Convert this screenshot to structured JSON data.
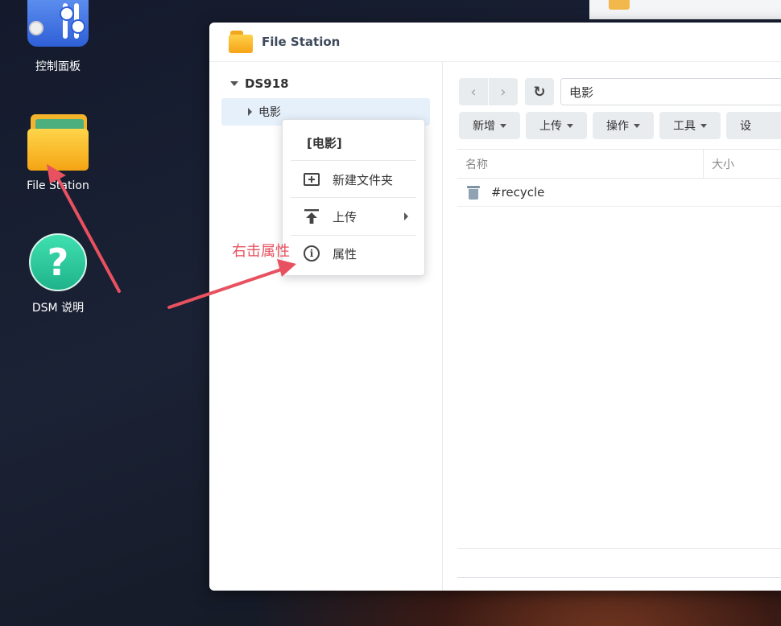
{
  "desktop": {
    "icons": [
      {
        "label": "控制面板",
        "icon": "control-panel-icon"
      },
      {
        "label": "File Station",
        "icon": "folder-icon"
      },
      {
        "label": "DSM 说明",
        "icon": "help-icon"
      }
    ]
  },
  "window": {
    "title": "File Station",
    "tree": {
      "root": "DS918",
      "items": [
        "电影"
      ]
    },
    "path": "电影",
    "toolbar": [
      "新增",
      "上传",
      "操作",
      "工具",
      "设"
    ],
    "columns": {
      "name": "名称",
      "size": "大小"
    },
    "rows": [
      {
        "name": "#recycle",
        "icon": "trash-icon"
      }
    ]
  },
  "context_menu": {
    "title": "[电影]",
    "items": [
      {
        "label": "新建文件夹",
        "icon": "new-folder-icon"
      },
      {
        "label": "上传",
        "icon": "upload-icon",
        "submenu": true
      },
      {
        "label": "属性",
        "icon": "info-icon"
      }
    ]
  },
  "annotation": {
    "text": "右击属性",
    "color": "#e8515f"
  }
}
